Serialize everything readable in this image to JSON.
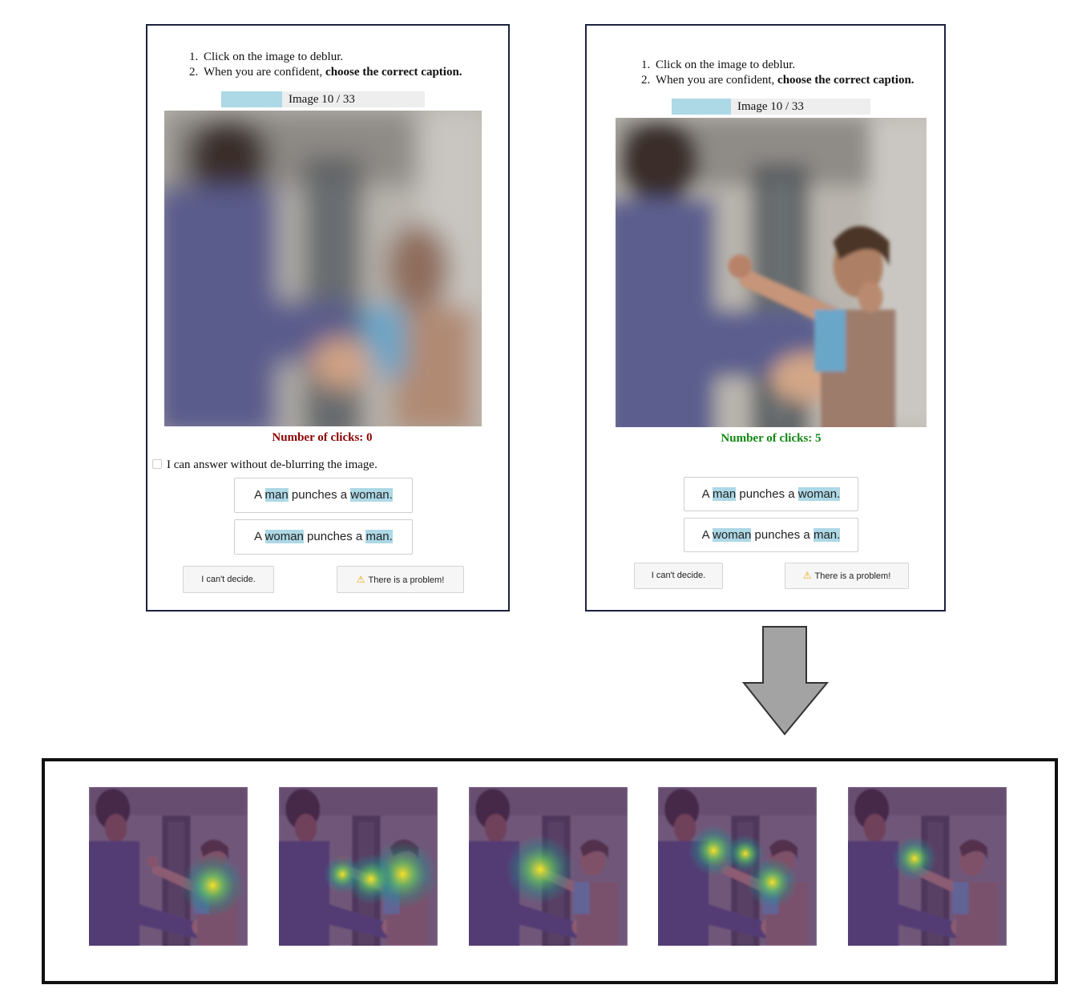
{
  "left_panel": {
    "instructions": [
      {
        "num": "1.",
        "text": "Click on the image to deblur.",
        "bold": ""
      },
      {
        "num": "2.",
        "text": "When you are confident, ",
        "bold": "choose the correct caption."
      }
    ],
    "progress": {
      "text": "Image 10 / 33",
      "fill_fraction": 0.3
    },
    "clicks_label": "Number of clicks: 0",
    "clicks_color": "#8b0000",
    "checkbox_label": "I can answer without de-blurring the image.",
    "captions": [
      [
        "A ",
        "man",
        " punches a ",
        "woman."
      ],
      [
        "A ",
        "woman",
        " punches a ",
        "man."
      ]
    ],
    "cant_decide": "I can't decide.",
    "problem": "There is a problem!",
    "warning_icon": "⚠"
  },
  "right_panel": {
    "instructions": [
      {
        "num": "1.",
        "text": "Click on the image to deblur.",
        "bold": ""
      },
      {
        "num": "2.",
        "text": "When you are confident, ",
        "bold": "choose the correct caption."
      }
    ],
    "progress": {
      "text": "Image 10 / 33",
      "fill_fraction": 0.3
    },
    "clicks_label": "Number of clicks: 5",
    "clicks_color": "#118811",
    "captions": [
      [
        "A ",
        "man",
        " punches a ",
        "woman."
      ],
      [
        "A ",
        "woman",
        " punches a ",
        "man."
      ]
    ],
    "cant_decide": "I can't decide.",
    "problem": "There is a problem!",
    "warning_icon": "⚠"
  },
  "colors": {
    "panel_border": "#1c2140",
    "highlight": "#add8e6",
    "progress_bg": "#eeeeee",
    "arrow_fill": "#a3a3a3",
    "heatmap_tint": "#5b2d6e"
  },
  "heatmaps": [
    {
      "focus": "woman-torso"
    },
    {
      "focus": "woman-and-arm"
    },
    {
      "focus": "fist"
    },
    {
      "focus": "fist-and-woman"
    },
    {
      "focus": "fist-small"
    }
  ]
}
